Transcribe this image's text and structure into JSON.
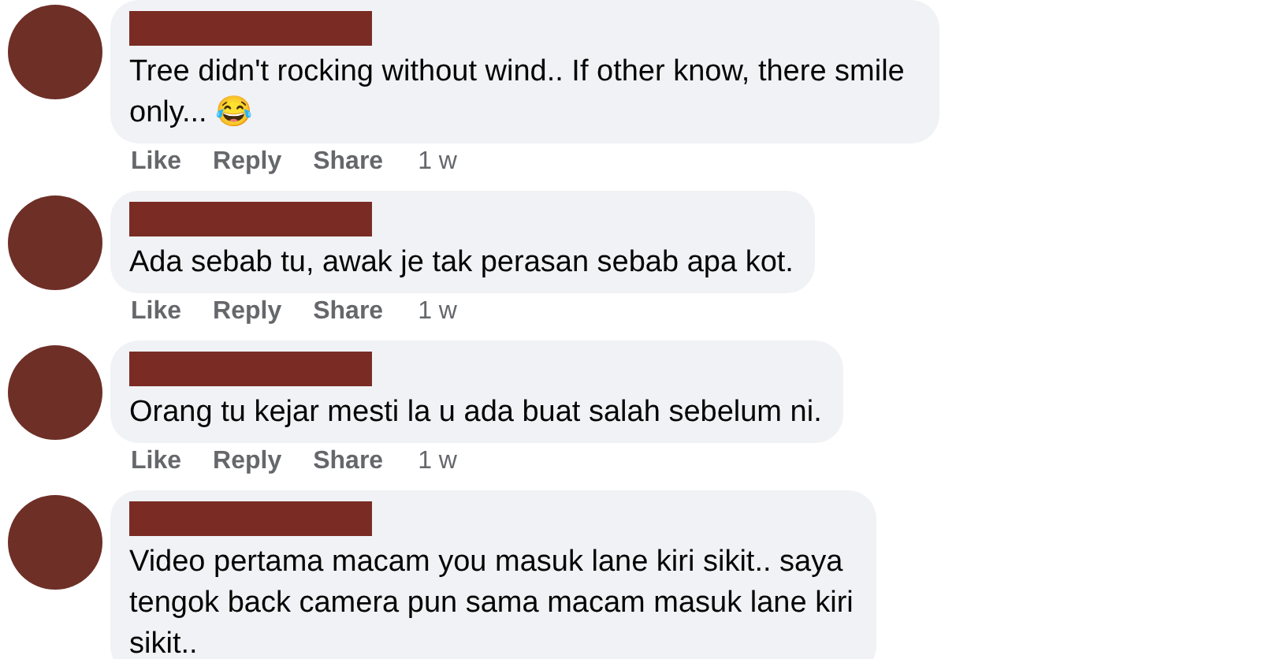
{
  "comments": [
    {
      "text": "Tree didn't rocking without wind.. If other know, there smile only... 😂",
      "actions": [
        "Like",
        "Reply",
        "Share"
      ],
      "time": "1 w"
    },
    {
      "text": "Ada sebab tu, awak je tak perasan sebab apa kot.",
      "actions": [
        "Like",
        "Reply",
        "Share"
      ],
      "time": "1 w"
    },
    {
      "text": "Orang tu kejar mesti la u ada buat salah sebelum ni.",
      "actions": [
        "Like",
        "Reply",
        "Share"
      ],
      "time": "1 w"
    },
    {
      "text": "Video pertama macam you masuk lane kiri sikit.. saya tengok back camera pun sama macam masuk lane kiri sikit.."
    }
  ]
}
